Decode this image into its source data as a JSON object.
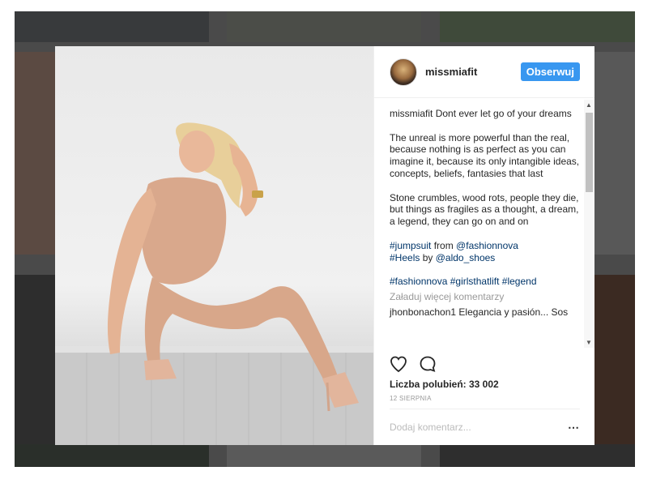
{
  "post": {
    "username": "missmiafit",
    "follow_label": "Obserwuj",
    "caption_user": "missmiafit",
    "caption_line1": "Dont ever let go of your dreams",
    "paragraph2": "The unreal is more powerful than the real, because nothing is as perfect as you can imagine it, because its only intangible ideas, concepts, beliefs, fantasies that last",
    "paragraph3": "Stone crumbles, wood rots, people they die, but things as fragiles as a thought, a dream, a legend, they can go on and on",
    "credit1_tag": "#jumpsuit",
    "credit1_from": "from",
    "credit1_handle": "@fashionnova",
    "credit2_tag": "#Heels",
    "credit2_by": "by",
    "credit2_handle": "@aldo_shoes",
    "hashtag1": "#fashionnova",
    "hashtag2": "#girlsthatlift",
    "hashtag3": "#legend",
    "load_more": "Załaduj więcej komentarzy",
    "comment_user": "jhonbonachon1",
    "comment_text": "Elegancia y pasión... Sos",
    "likes": "Liczba polubień: 33 002",
    "date": "12 SIERPNIA",
    "add_comment_placeholder": "Dodaj komentarz...",
    "more_icon": "⋯"
  },
  "icons": {
    "like": "heart-icon",
    "comment": "comment-bubble-icon",
    "more": "more-options-icon"
  },
  "colors": {
    "follow_button": "#3897f0",
    "hashtag": "#003569",
    "text": "#262626"
  }
}
